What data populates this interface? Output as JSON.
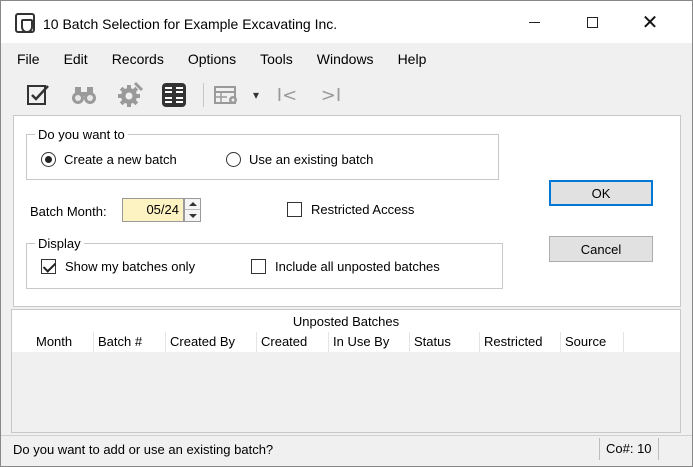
{
  "window": {
    "title": "10 Batch Selection for Example Excavating Inc.",
    "icon": "app-icon"
  },
  "menu": [
    "File",
    "Edit",
    "Records",
    "Options",
    "Tools",
    "Windows",
    "Help"
  ],
  "toolbar": {
    "icons": [
      "checklist-icon",
      "binoculars-icon",
      "gear-icon",
      "layout-icon",
      "grid-settings-icon",
      "dropdown-arrow-icon",
      "first-record-icon",
      "last-record-icon"
    ],
    "first_glyph": "I<",
    "last_glyph": ">I",
    "dropdown_glyph": "▾"
  },
  "form": {
    "question_group": "Do you want to",
    "radio_new": "Create a new batch",
    "radio_existing": "Use an existing batch",
    "selected_radio": "new",
    "batch_month_label": "Batch Month:",
    "batch_month_value": "05/24",
    "restricted_access": "Restricted Access",
    "restricted_checked": false,
    "display_group": "Display",
    "show_mine": "Show my batches only",
    "show_mine_checked": true,
    "include_unposted": "Include all unposted batches",
    "include_unposted_checked": false
  },
  "buttons": {
    "ok": "OK",
    "cancel": "Cancel"
  },
  "grid": {
    "title": "Unposted Batches",
    "columns": [
      "Month",
      "Batch #",
      "Created By",
      "Created",
      "In Use By",
      "Status",
      "Restricted",
      "Source"
    ]
  },
  "status": {
    "message": "Do you want to add or use an existing batch?",
    "company": "Co#: 10"
  },
  "colors": {
    "input_highlight": "#fdf3c2",
    "default_button_border": "#0078d7"
  }
}
